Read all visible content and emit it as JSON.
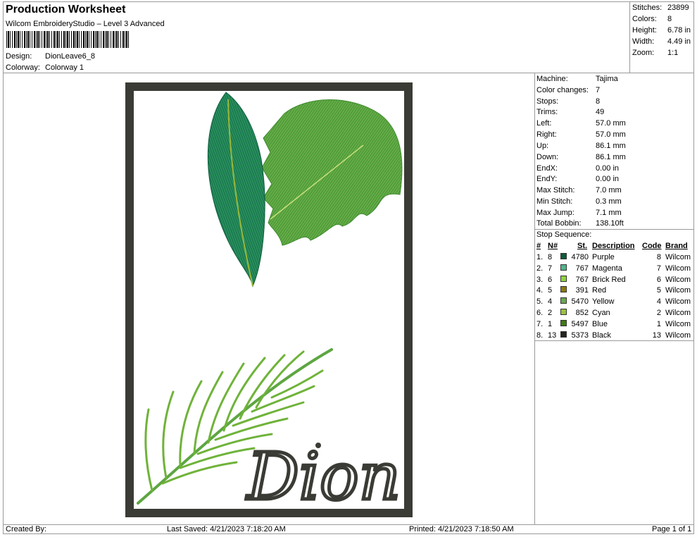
{
  "header": {
    "title": "Production Worksheet",
    "subtitle": "Wilcom EmbroideryStudio – Level 3 Advanced",
    "design_label": "Design:",
    "design_value": "DionLeave6_8",
    "colorway_label": "Colorway:",
    "colorway_value": "Colorway 1"
  },
  "stats": [
    {
      "label": "Stitches:",
      "value": "23899"
    },
    {
      "label": "Colors:",
      "value": "8"
    },
    {
      "label": "Height:",
      "value": "6.78 in"
    },
    {
      "label": "Width:",
      "value": "4.49 in"
    },
    {
      "label": "Zoom:",
      "value": "1:1"
    }
  ],
  "specs": [
    {
      "label": "Machine:",
      "value": "Tajima"
    },
    {
      "label": "Color changes:",
      "value": "7"
    },
    {
      "label": "Stops:",
      "value": "8"
    },
    {
      "label": "Trims:",
      "value": "49"
    },
    {
      "label": "Left:",
      "value": "57.0 mm"
    },
    {
      "label": "Right:",
      "value": "57.0 mm"
    },
    {
      "label": "Up:",
      "value": "86.1 mm"
    },
    {
      "label": "Down:",
      "value": "86.1 mm"
    },
    {
      "label": "EndX:",
      "value": "0.00 in"
    },
    {
      "label": "EndY:",
      "value": "0.00 in"
    },
    {
      "label": "Max Stitch:",
      "value": "7.0 mm"
    },
    {
      "label": "Min Stitch:",
      "value": "0.3 mm"
    },
    {
      "label": "Max Jump:",
      "value": "7.1 mm"
    },
    {
      "label": "Total Bobbin:",
      "value": "138.10ft"
    }
  ],
  "stop_sequence": {
    "title": "Stop Sequence:",
    "headers": {
      "num": "#",
      "n": "N#",
      "st": "St.",
      "desc": "Description",
      "code": "Code",
      "brand": "Brand"
    },
    "rows": [
      {
        "num": "1.",
        "n": "8",
        "color": "#0e5b3c",
        "st": "4780",
        "desc": "Purple",
        "code": "8",
        "brand": "Wilcom"
      },
      {
        "num": "2.",
        "n": "7",
        "color": "#4fb58a",
        "st": "767",
        "desc": "Magenta",
        "code": "7",
        "brand": "Wilcom"
      },
      {
        "num": "3.",
        "n": "6",
        "color": "#8ed43a",
        "st": "767",
        "desc": "Brick Red",
        "code": "6",
        "brand": "Wilcom"
      },
      {
        "num": "4.",
        "n": "5",
        "color": "#8a7a14",
        "st": "391",
        "desc": "Red",
        "code": "5",
        "brand": "Wilcom"
      },
      {
        "num": "5.",
        "n": "4",
        "color": "#6aa84f",
        "st": "5470",
        "desc": "Yellow",
        "code": "4",
        "brand": "Wilcom"
      },
      {
        "num": "6.",
        "n": "2",
        "color": "#9ac23c",
        "st": "852",
        "desc": "Cyan",
        "code": "2",
        "brand": "Wilcom"
      },
      {
        "num": "7.",
        "n": "1",
        "color": "#3f7a16",
        "st": "5497",
        "desc": "Blue",
        "code": "1",
        "brand": "Wilcom"
      },
      {
        "num": "8.",
        "n": "13",
        "color": "#242420",
        "st": "5373",
        "desc": "Black",
        "code": "13",
        "brand": "Wilcom"
      }
    ]
  },
  "design": {
    "name_text": "Dion",
    "border_color": "#3b3b36",
    "leaf_dark": "#1e7a4e",
    "leaf_mid": "#5da641",
    "leaf_light": "#7cc043"
  },
  "footer": {
    "created_by": "Created By:",
    "last_saved": "Last Saved: 4/21/2023 7:18:20 AM",
    "printed": "Printed: 4/21/2023 7:18:50 AM",
    "page": "Page 1 of 1"
  }
}
